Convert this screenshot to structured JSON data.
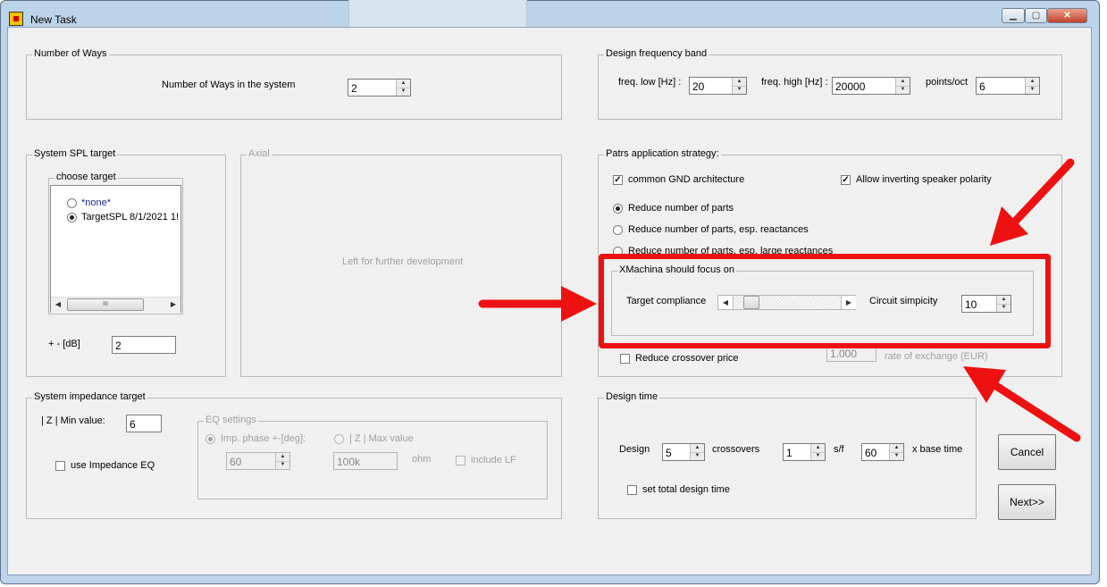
{
  "window": {
    "title": "New Task",
    "minimize_glyph": "▁",
    "maximize_glyph": "▢",
    "close_glyph": "✕"
  },
  "ways": {
    "title": "Number of Ways",
    "label": "Number of Ways in the system",
    "value": "2"
  },
  "band": {
    "title": "Design frequency band",
    "low_label": "freq. low [Hz] :",
    "low_value": "20",
    "high_label": "freq. high [Hz] :",
    "high_value": "20000",
    "points_label": "points/oct",
    "points_value": "6"
  },
  "spl": {
    "title": "System SPL target",
    "choose_title": "choose target",
    "options": [
      "*none*",
      "TargetSPL 8/1/2021 1!"
    ],
    "selected_index": 1,
    "tolerance_label": "+ - [dB]",
    "tolerance_value": "2",
    "scroll_left": "◀",
    "scroll_right": "▶",
    "thumb_grip": "III"
  },
  "axial": {
    "title": "Axial",
    "placeholder": "Left for further development"
  },
  "strategy": {
    "title": "Patrs application strategy:",
    "common_gnd": {
      "label": "common GND architecture",
      "checked": true
    },
    "invert_polarity": {
      "label": "Allow inverting speaker polarity",
      "checked": true
    },
    "radio1": "Reduce number of parts",
    "radio2": "Reduce number of parts, esp. reactances",
    "radio3": "Reduce number of parts, esp. large reactances",
    "focus_title": "XMachina should focus on",
    "target_compliance": "Target compliance",
    "circuit_simplicity": "Circuit simpicity",
    "simplicity_value": "10",
    "reduce_price": "Reduce crossover price",
    "exchange_value": "1.000",
    "exchange_label": "rate of exchange (EUR)",
    "slider_left": "◀",
    "slider_right": "▶"
  },
  "impedance": {
    "title": "System impedance target",
    "min_label": "| Z | Min value:",
    "min_value": "6",
    "use_eq": "use Impedance EQ",
    "eq_title": "EQ settings",
    "phase_label": "Imp. phase +-[deg]:",
    "phase_value": "60",
    "max_label": "| Z | Max value",
    "max_value": "100k",
    "ohm_label": "ohm",
    "include_lf": "include LF"
  },
  "design_time": {
    "title": "Design time",
    "design_label": "Design",
    "design_value": "5",
    "crossovers_label": "crossovers",
    "sf_value": "1",
    "sf_label": "s/f",
    "base_value": "60",
    "base_label": "x base time",
    "set_total": "set total design time"
  },
  "buttons": {
    "cancel": "Cancel",
    "next": "Next>>"
  },
  "annotation_color": "#ee1111",
  "spin_up": "▲",
  "spin_down": "▼",
  "check_mark": "✓"
}
